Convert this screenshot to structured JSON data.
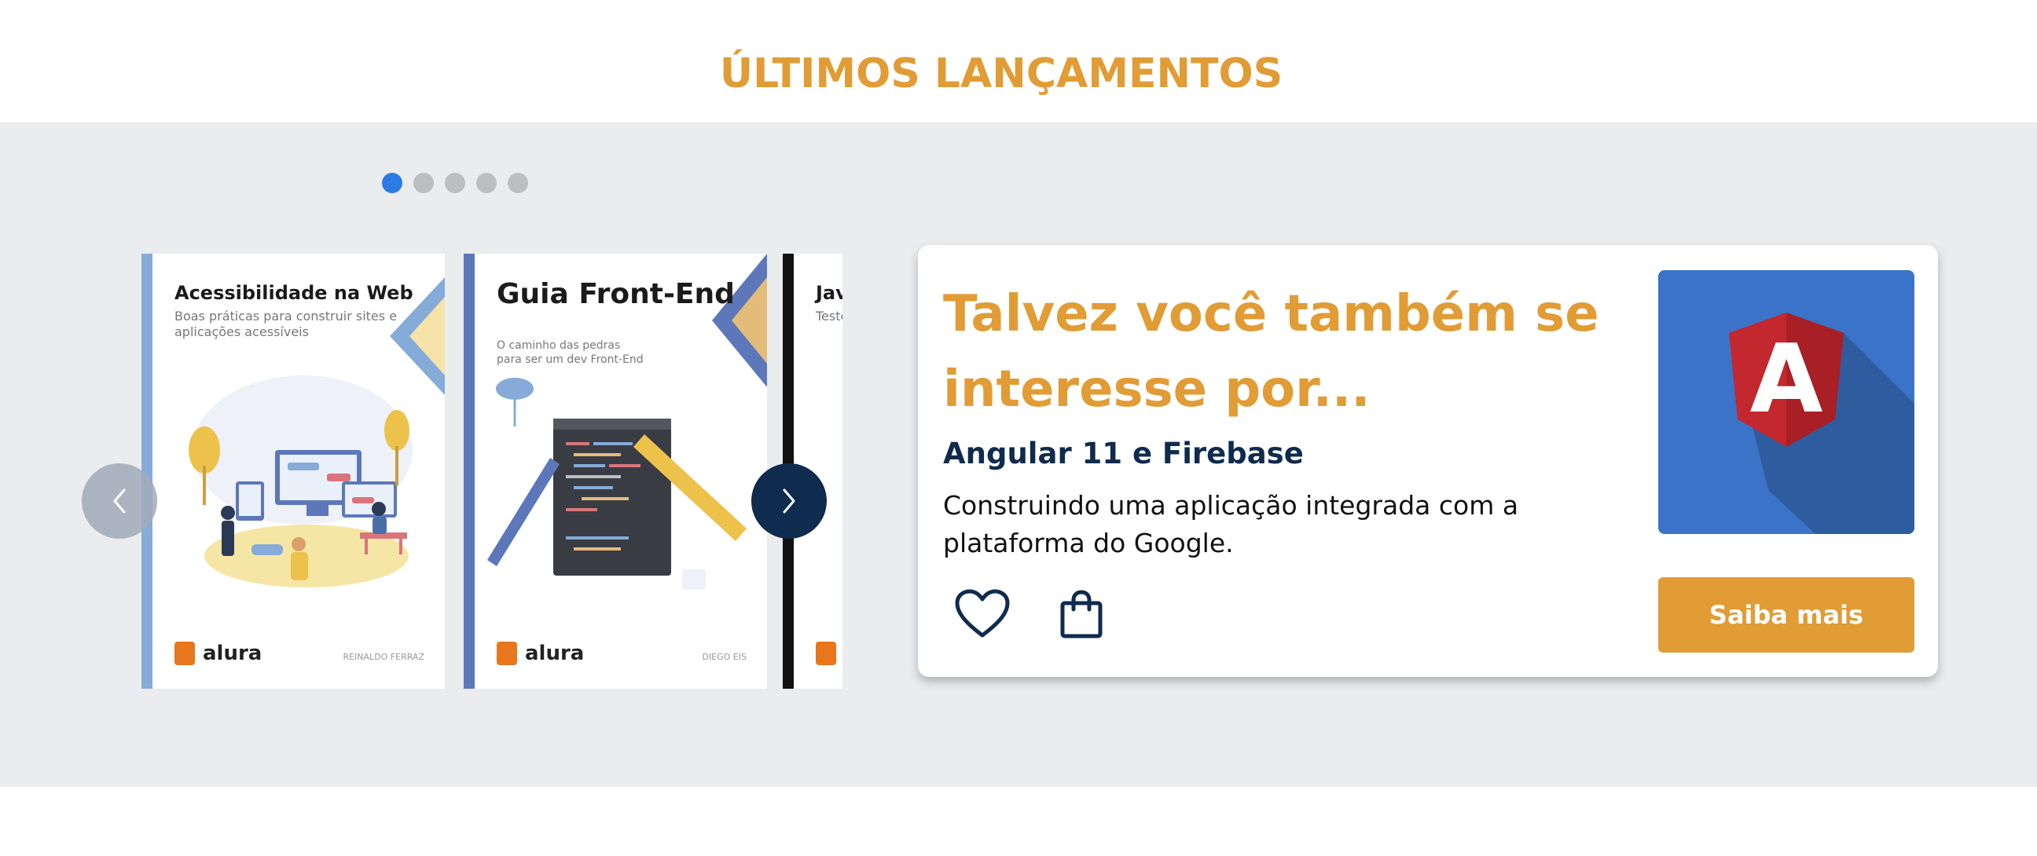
{
  "section": {
    "title": "ÚLTIMOS LANÇAMENTOS"
  },
  "carousel": {
    "dots": [
      true,
      false,
      false,
      false,
      false
    ],
    "books": [
      {
        "title": "Acessibilidade na Web",
        "subtitle": "Boas práticas para construir sites e aplicações acessíveis",
        "brand": "alura",
        "author": "REINALDO FERRAZ"
      },
      {
        "title": "Guia Front-End",
        "subtitle": "O caminho das pedras para ser um dev Front-End",
        "brand": "alura",
        "author": "DIEGO EIS"
      },
      {
        "title": "Jav",
        "subtitle": "Teste em to"
      }
    ],
    "prev_icon": "chevron-left-icon",
    "next_icon": "chevron-right-icon"
  },
  "recommendation": {
    "heading": "Talvez você também se interesse por...",
    "book_title": "Angular 11 e Firebase",
    "description": "Construindo uma aplicação integrada com a plataforma do Google.",
    "cta": "Saiba mais",
    "thumb_letter": "A",
    "favorite_icon": "heart-icon",
    "cart_icon": "shopping-bag-icon"
  },
  "colors": {
    "accent": "#E19C35",
    "navy": "#0F2B4D",
    "dot_active": "#2C7BE5",
    "band": "#EBECEE",
    "angular_red": "#C3282E",
    "thumb_bg": "#3B73C8"
  }
}
